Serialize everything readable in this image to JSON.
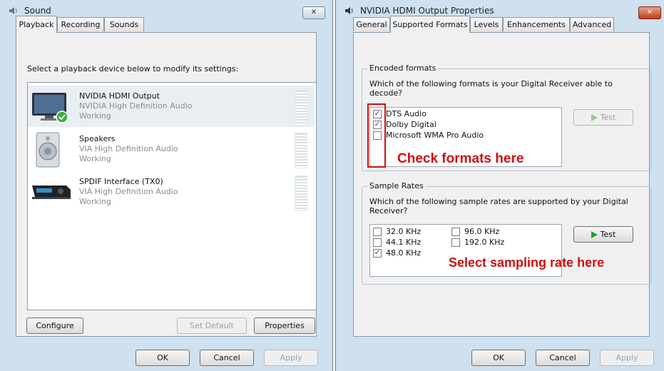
{
  "sound_dialog": {
    "title": "Sound",
    "close_label": "✕",
    "tabs": [
      "Playback",
      "Recording",
      "Sounds"
    ],
    "instruction": "Select a playback device below to modify its settings:",
    "devices": [
      {
        "name": "NVIDIA HDMI Output",
        "driver": "NVIDIA High Definition Audio",
        "status": "Working"
      },
      {
        "name": "Speakers",
        "driver": "VIA High Definition Audio",
        "status": "Working"
      },
      {
        "name": "SPDIF Interface (TX0)",
        "driver": "VIA High Definition Audio",
        "status": "Working"
      }
    ],
    "buttons": {
      "configure": "Configure",
      "set_default": "Set Default",
      "properties": "Properties",
      "ok": "OK",
      "cancel": "Cancel",
      "apply": "Apply"
    }
  },
  "props_dialog": {
    "title": "NVIDIA HDMI Output Properties",
    "close_label": "✕",
    "tabs": [
      "General",
      "Supported Formats",
      "Levels",
      "Enhancements",
      "Advanced"
    ],
    "encoded": {
      "title": "Encoded formats",
      "question": "Which of the following formats is your Digital Receiver able to decode?",
      "formats": [
        {
          "label": "DTS Audio",
          "checked": true
        },
        {
          "label": "Dolby Digital",
          "checked": true
        },
        {
          "label": "Microsoft WMA Pro Audio",
          "checked": false
        }
      ],
      "test_label": "Test"
    },
    "rates": {
      "title": "Sample Rates",
      "question": "Which of the following sample rates are supported by your Digital Receiver?",
      "options": [
        {
          "label": "32.0 KHz",
          "checked": false
        },
        {
          "label": "44.1 KHz",
          "checked": false
        },
        {
          "label": "48.0 KHz",
          "checked": true
        },
        {
          "label": "96.0 KHz",
          "checked": false
        },
        {
          "label": "192.0 KHz",
          "checked": false
        }
      ],
      "test_label": "Test"
    },
    "buttons": {
      "ok": "OK",
      "cancel": "Cancel",
      "apply": "Apply"
    }
  },
  "annotations": {
    "formats": "Check formats here",
    "rates": "Select sampling rate here"
  },
  "colors": {
    "annotation": "#cc1111",
    "play_arrow": "#2c9a2c",
    "checkmark": "#1c3f8e"
  }
}
